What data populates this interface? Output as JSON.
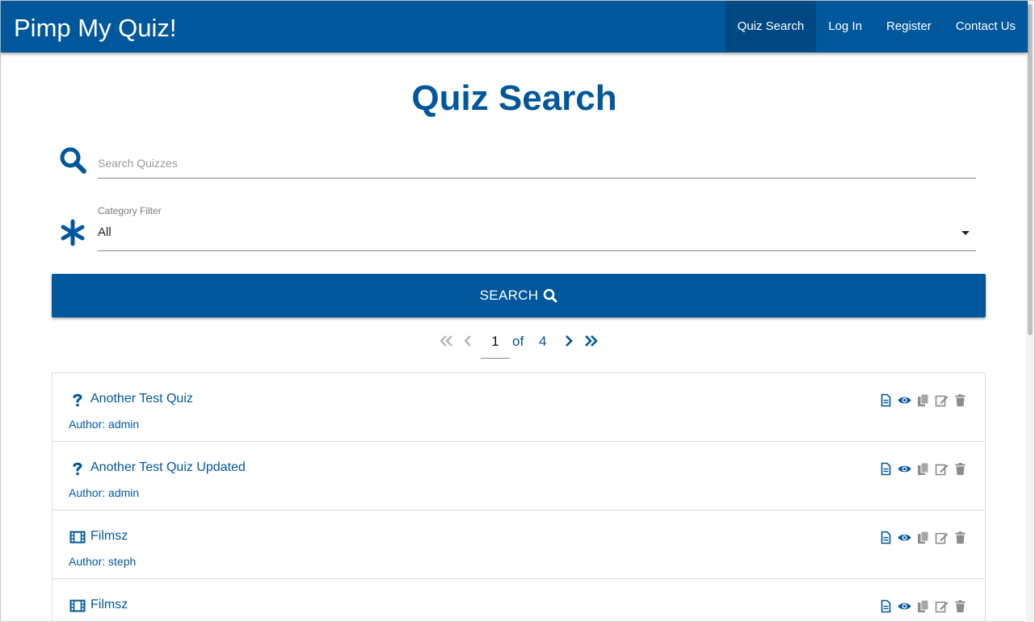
{
  "header": {
    "brand": "Pimp My Quiz!",
    "nav": [
      {
        "label": "Quiz Search",
        "active": true
      },
      {
        "label": "Log In",
        "active": false
      },
      {
        "label": "Register",
        "active": false
      },
      {
        "label": "Contact Us",
        "active": false
      }
    ]
  },
  "page": {
    "title": "Quiz Search"
  },
  "search": {
    "placeholder": "Search Quizzes",
    "value": "",
    "icon": "search-icon"
  },
  "category": {
    "label": "Category Filter",
    "value": "All",
    "icon": "asterisk-icon"
  },
  "search_button": {
    "label": "SEARCH",
    "icon": "search-icon"
  },
  "pagination": {
    "current": "1",
    "of_label": "of",
    "total": "4"
  },
  "quizzes": [
    {
      "title": "Another Test Quiz",
      "author": "Author: admin",
      "type_icon": "question-icon"
    },
    {
      "title": "Another Test Quiz Updated",
      "author": "Author: admin",
      "type_icon": "question-icon"
    },
    {
      "title": "Filmsz",
      "author": "Author: steph",
      "type_icon": "film-icon"
    },
    {
      "title": "Filmsz",
      "author": "",
      "type_icon": "film-icon"
    }
  ],
  "colors": {
    "brand": "#00579c",
    "nav_active": "#004883",
    "action_primary": "#00579c",
    "action_muted": "#8c8c8c"
  }
}
